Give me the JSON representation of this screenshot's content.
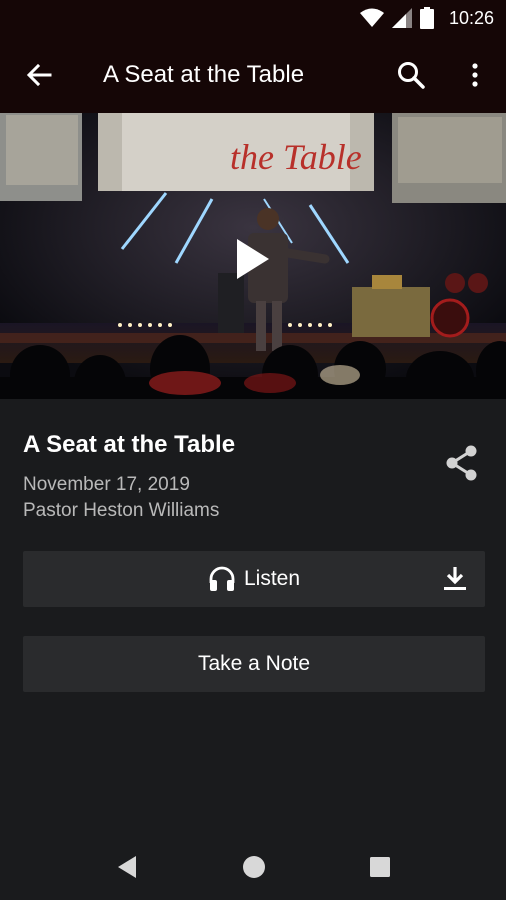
{
  "status": {
    "time": "10:26"
  },
  "app_bar": {
    "title": "A Seat at the Table"
  },
  "video": {
    "screen_text": "the Table"
  },
  "sermon": {
    "title": "A Seat at the Table",
    "date": "November 17, 2019",
    "speaker": "Pastor Heston Williams"
  },
  "actions": {
    "listen_label": "Listen",
    "note_label": "Take a Note"
  },
  "colors": {
    "header_bg": "#150606",
    "page_bg": "#1a1b1d",
    "button_bg": "#2a2b2d",
    "secondary_text": "#b9b9b9",
    "accent": "#b8302a"
  },
  "icons": [
    "wifi-icon",
    "cell-signal-icon",
    "battery-icon",
    "back-arrow-icon",
    "search-icon",
    "more-vert-icon",
    "play-icon",
    "share-icon",
    "headphones-icon",
    "download-icon",
    "nav-back-icon",
    "nav-home-icon",
    "nav-recents-icon"
  ]
}
